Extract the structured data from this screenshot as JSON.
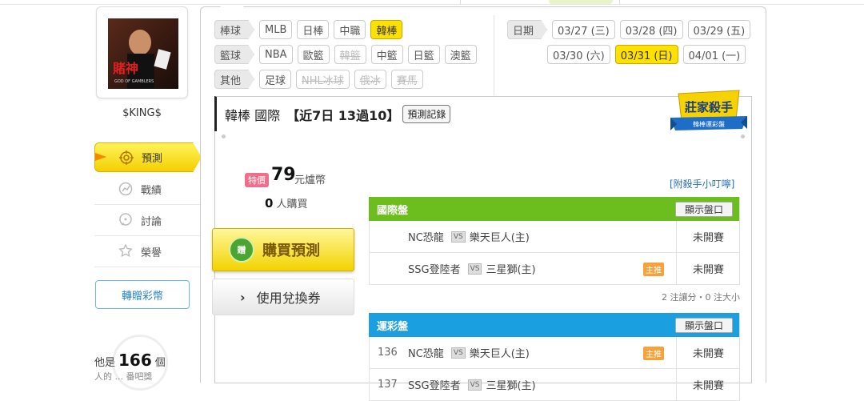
{
  "user": {
    "name": "$KING$",
    "avatar_text": "賭神",
    "avatar_subtext": "GOD OF GAMBLERS"
  },
  "nav": [
    {
      "label": "預測",
      "icon": "target-icon",
      "active": true
    },
    {
      "label": "戰績",
      "icon": "chart-icon",
      "active": false
    },
    {
      "label": "討論",
      "icon": "chat-icon",
      "active": false
    },
    {
      "label": "榮譽",
      "icon": "trophy-icon",
      "active": false
    }
  ],
  "gift_button": "轉贈彩幣",
  "counter": {
    "prefix": "他是",
    "value": "166",
    "suffix": "個",
    "subtext": "人的 ... 番吧獎"
  },
  "filters": {
    "baseball": {
      "label": "棒球",
      "items": [
        "MLB",
        "日棒",
        "中職",
        "韓棒"
      ],
      "active": "韓棒"
    },
    "basketball": {
      "label": "籃球",
      "items": [
        "NBA",
        "歐籃",
        "韓籃",
        "中籃",
        "日籃",
        "澳籃"
      ],
      "disabled": [
        "韓籃"
      ]
    },
    "other": {
      "label": "其他",
      "items": [
        "足球",
        "NHL冰球",
        "俄冰",
        "賽馬"
      ],
      "disabled": [
        "NHL冰球",
        "俄冰",
        "賽馬"
      ]
    }
  },
  "dates": {
    "label": "日期",
    "items": [
      "03/27 (三)",
      "03/28 (四)",
      "03/29 (五)",
      "03/30 (六)",
      "03/31 (日)",
      "04/01 (一)"
    ],
    "active": "03/31 (日)"
  },
  "title": {
    "main": "韓棒 國際",
    "record": "【近7日 13過10】",
    "record_button": "預測記錄"
  },
  "badge": {
    "title": "莊家殺手",
    "subtitle": "韓棒運彩盤"
  },
  "price": {
    "tag": "特價",
    "amount": "79",
    "unit": "元爐幣"
  },
  "buyers": {
    "count": "0",
    "label": "人購買"
  },
  "buy_button": "購買預測",
  "buy_coin": "贈",
  "coupon_button": "使用兌換券",
  "tip_link": "[附殺手小叮嚀]",
  "tables": [
    {
      "title": "國際盤",
      "color": "#6cbd1e",
      "show_button": "顯示盤口",
      "games": [
        {
          "num": "",
          "away": "NC恐龍",
          "home": "樂天巨人(主)",
          "tag": "",
          "status": "未開賽"
        },
        {
          "num": "",
          "away": "SSG登陸者",
          "home": "三星獅(主)",
          "tag": "主推",
          "status": "未開賽"
        }
      ],
      "note": "2 注讓分・0 注大小"
    },
    {
      "title": "運彩盤",
      "color": "#1a9fe0",
      "show_button": "顯示盤口",
      "games": [
        {
          "num": "136",
          "away": "NC恐龍",
          "home": "樂天巨人(主)",
          "tag": "主推",
          "status": "未開賽"
        },
        {
          "num": "137",
          "away": "SSG登陸者",
          "home": "三星獅(主)",
          "tag": "",
          "status": "未開賽"
        }
      ]
    }
  ],
  "vs_label": "VS"
}
